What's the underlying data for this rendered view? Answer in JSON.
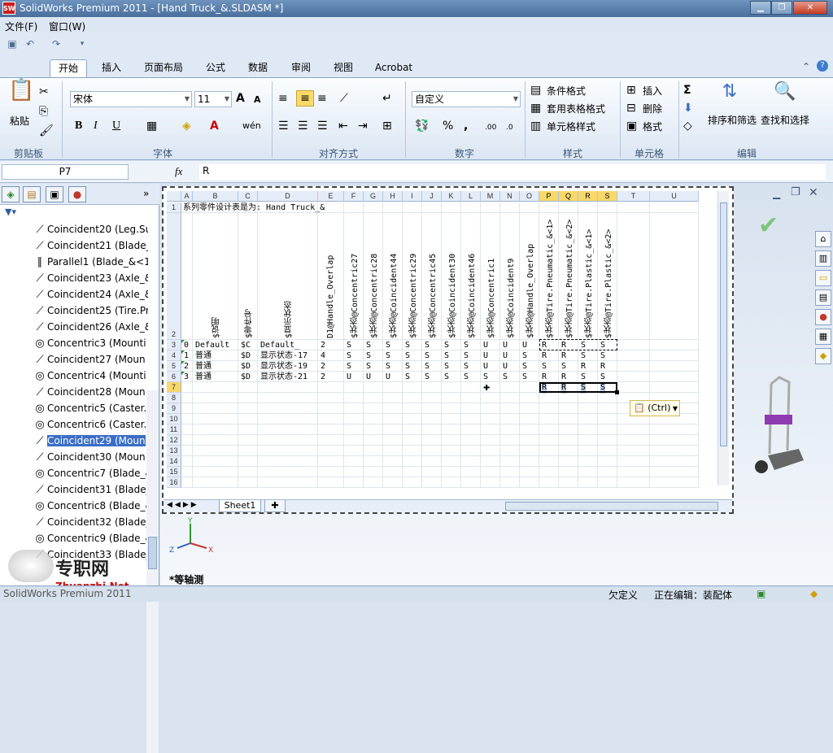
{
  "window": {
    "title": "SolidWorks Premium 2011 - [Hand Truck_&.SLDASM *]",
    "app_logo": "SW"
  },
  "menu": [
    "文件(F)",
    "窗口(W)"
  ],
  "ribbon_tabs": [
    "开始",
    "插入",
    "页面布局",
    "公式",
    "数据",
    "审阅",
    "视图",
    "Acrobat"
  ],
  "clipboard": {
    "paste": "粘贴",
    "label": "剪贴板"
  },
  "font": {
    "name": "宋体",
    "size": "11",
    "label": "字体",
    "bold": "B",
    "italic": "I",
    "underline": "U",
    "color": "A",
    "size_up": "A",
    "size_down": "A",
    "phonetic": "wén"
  },
  "alignment": {
    "label": "对齐方式"
  },
  "number": {
    "format": "自定义",
    "label": "数字",
    "percent": "%",
    "comma": ","
  },
  "styles": {
    "cond": "条件格式",
    "table": "套用表格格式",
    "cell": "单元格样式",
    "label": "样式"
  },
  "cells": {
    "insert": "插入",
    "delete": "删除",
    "format": "格式",
    "label": "单元格"
  },
  "editing": {
    "sort": "排序和筛选",
    "find": "查找和选择",
    "label": "编辑",
    "sigma": "Σ"
  },
  "formula_bar": {
    "name": "P7",
    "fx": "fx",
    "value": "R"
  },
  "tree": [
    {
      "icon": "coincident",
      "label": "Coincident20 (Leg.Su"
    },
    {
      "icon": "coincident",
      "label": "Coincident21 (Blade_"
    },
    {
      "icon": "parallel",
      "label": "Parallel1 (Blade_&<1"
    },
    {
      "icon": "coincident",
      "label": "Coincident23 (Axle_&"
    },
    {
      "icon": "coincident",
      "label": "Coincident24 (Axle_&"
    },
    {
      "icon": "coincident",
      "label": "Coincident25 (Tire.Pn"
    },
    {
      "icon": "coincident",
      "label": "Coincident26 (Axle_&"
    },
    {
      "icon": "concentric",
      "label": "Concentric3 (Mounti"
    },
    {
      "icon": "coincident",
      "label": "Coincident27 (Moun"
    },
    {
      "icon": "concentric",
      "label": "Concentric4 (Mounti"
    },
    {
      "icon": "coincident",
      "label": "Coincident28 (Moun"
    },
    {
      "icon": "concentric",
      "label": "Concentric5 (Caster."
    },
    {
      "icon": "concentric",
      "label": "Concentric6 (Caster."
    },
    {
      "icon": "coincident",
      "label": "Coincident29 (Moun",
      "selected": true
    },
    {
      "icon": "coincident",
      "label": "Coincident30 (Moun"
    },
    {
      "icon": "concentric",
      "label": "Concentric7 (Blade_&"
    },
    {
      "icon": "coincident",
      "label": "Coincident31 (Blade_"
    },
    {
      "icon": "concentric",
      "label": "Concentric8 (Blade_&"
    },
    {
      "icon": "coincident",
      "label": "Coincident32 (Blade_"
    },
    {
      "icon": "concentric",
      "label": "Concentric9 (Blade_&"
    },
    {
      "icon": "coincident",
      "label": "Coincident33 (Blade_"
    }
  ],
  "sheet": {
    "columns": [
      "A",
      "B",
      "C",
      "D",
      "E",
      "F",
      "G",
      "H",
      "I",
      "J",
      "K",
      "L",
      "M",
      "N",
      "O",
      "P",
      "Q",
      "R",
      "S",
      "T",
      "U"
    ],
    "rows": [
      "1",
      "2",
      "3",
      "4",
      "5",
      "6",
      "7",
      "8",
      "9",
      "10",
      "11",
      "12",
      "13",
      "14",
      "15",
      "16"
    ],
    "title_cell": "系列零件设计表是为:  Hand Truck_&",
    "headers": [
      "$说明",
      "$零件号",
      "$显示状态",
      "D1@Handle_Overlap",
      "$状态@Concentric27",
      "$状态@Concentric28",
      "$状态@Coincident44",
      "$状态@Concentric29",
      "$状态@Concentric45",
      "$状态@Coincident30",
      "$状态@Coincident46",
      "$状态@Concentric1",
      "$状态@Coincident9",
      "$状态@Handle_Overlap",
      "$状态@Tire.Pneumatic_&<1>",
      "$状态@Tire.Pneumatic_&<2>",
      "$状态@Tire.Plastic_&<1>",
      "$状态@Tire.Plastic_&<2>"
    ],
    "data": [
      [
        "0",
        "Default",
        "$C",
        "Default_",
        "2",
        "S",
        "S",
        "S",
        "S",
        "S",
        "S",
        "S",
        "U",
        "U",
        "U",
        "R",
        "R",
        "S",
        "S"
      ],
      [
        "1",
        "普通",
        "$D",
        "显示状态-17",
        "4",
        "S",
        "S",
        "S",
        "S",
        "S",
        "S",
        "S",
        "U",
        "U",
        "S",
        "R",
        "R",
        "S",
        "S"
      ],
      [
        "2",
        "普通",
        "$D",
        "显示状态-19",
        "2",
        "S",
        "S",
        "S",
        "S",
        "S",
        "S",
        "S",
        "U",
        "U",
        "S",
        "S",
        "S",
        "R",
        "R"
      ],
      [
        "3",
        "普通",
        "$D",
        "显示状态-21",
        "2",
        "U",
        "U",
        "U",
        "S",
        "S",
        "S",
        "S",
        "S",
        "S",
        "S",
        "R",
        "R",
        "S",
        "S"
      ],
      [
        "",
        "",
        "",
        "",
        "",
        "",
        "",
        "",
        "",
        "",
        "",
        "",
        "",
        "",
        "",
        "R",
        "R",
        "S",
        "S"
      ]
    ],
    "sheet_tab": "Sheet1",
    "paste_options": "(Ctrl)"
  },
  "view": {
    "label": "*等轴测",
    "axis_x": "X",
    "axis_y": "Y",
    "axis_z": "Z"
  },
  "status": {
    "left": "SolidWorks Premium 2011",
    "undefined": "欠定义",
    "editing": "正在编辑：装配体"
  },
  "watermark": {
    "cn": "专职网",
    "en": "Zhuanzhi.Net"
  }
}
